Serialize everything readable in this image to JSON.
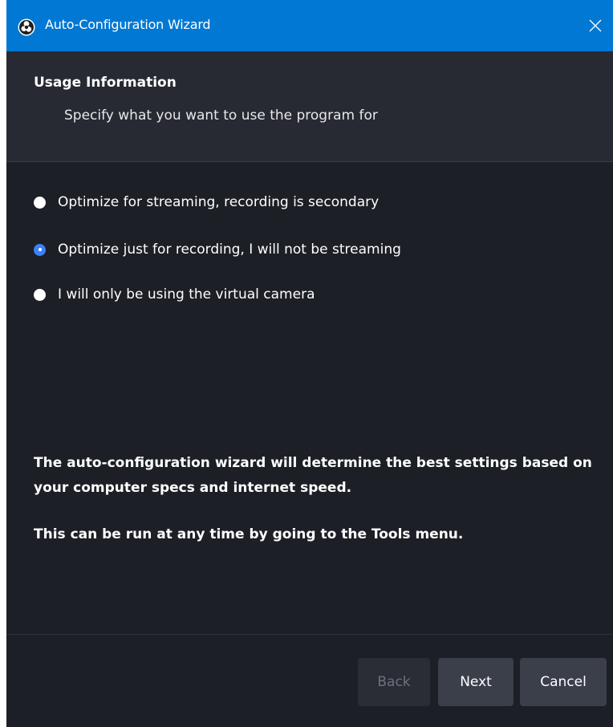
{
  "window": {
    "title": "Auto-Configuration Wizard"
  },
  "header": {
    "title": "Usage Information",
    "subtitle": "Specify what you want to use the program for"
  },
  "options": [
    {
      "label": "Optimize for streaming, recording is secondary",
      "checked": false
    },
    {
      "label": "Optimize just for recording, I will not be streaming",
      "checked": true
    },
    {
      "label": "I will only be using the virtual camera",
      "checked": false
    }
  ],
  "info": {
    "line1": "The auto-configuration wizard will determine the best settings based on your computer specs and internet speed.",
    "line2": "This can be run at any time by going to the Tools menu."
  },
  "buttons": {
    "back": "Back",
    "next": "Next",
    "cancel": "Cancel"
  },
  "colors": {
    "titlebar": "#0078d4",
    "accent": "#3a82f7",
    "background": "#1d1f26",
    "header_panel": "#272a33",
    "button": "#3b3f4a"
  }
}
